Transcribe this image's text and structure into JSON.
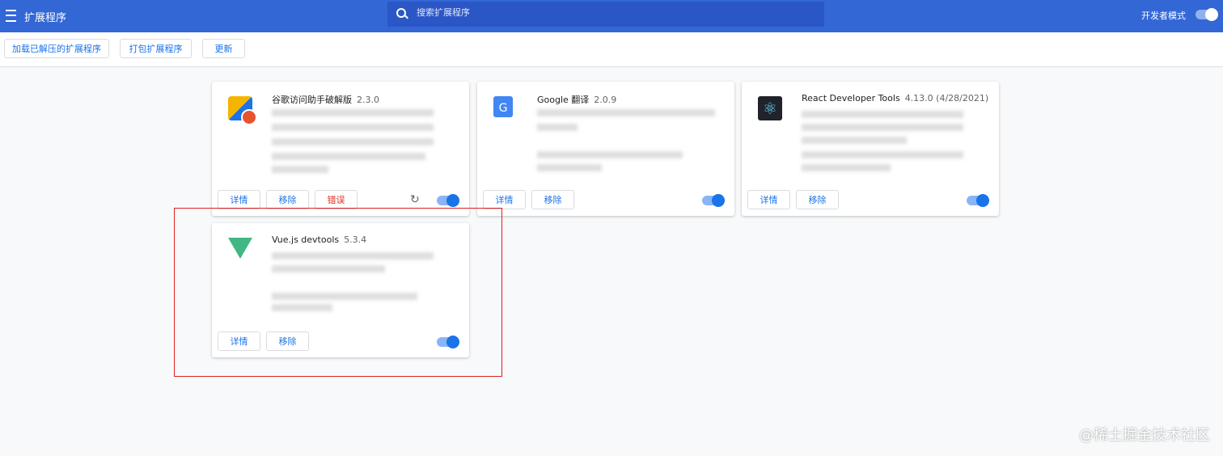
{
  "header": {
    "title": "扩展程序",
    "search_placeholder": "搜索扩展程序",
    "dev_mode_label": "开发者模式",
    "dev_mode_on": true
  },
  "toolbar": {
    "load_unpacked": "加载已解压的扩展程序",
    "pack": "打包扩展程序",
    "update": "更新"
  },
  "extensions": [
    {
      "name": "谷歌访问助手破解版",
      "version": "2.3.0",
      "enabled": true,
      "details": "详情",
      "remove": "移除",
      "errors": "错误"
    },
    {
      "name": "Google 翻译",
      "version": "2.0.9",
      "enabled": true,
      "details": "详情",
      "remove": "移除"
    },
    {
      "name": "React Developer Tools",
      "version": "4.13.0 (4/28/2021)",
      "enabled": true,
      "details": "详情",
      "remove": "移除"
    },
    {
      "name": "Vue.js devtools",
      "version": "5.3.4",
      "enabled": true,
      "details": "详情",
      "remove": "移除"
    }
  ],
  "watermark": "@稀土掘金技术社区"
}
